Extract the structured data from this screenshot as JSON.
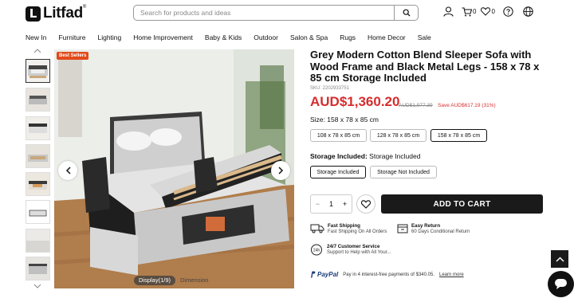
{
  "header": {
    "logo_text": "Litfad",
    "logo_mark": "L",
    "logo_reg": "®",
    "search_placeholder": "Search for products and ideas",
    "cart_count": "0",
    "wishlist_count": "0"
  },
  "nav": [
    "New In",
    "Furniture",
    "Lighting",
    "Home Improvement",
    "Baby & Kids",
    "Outdoor",
    "Salon & Spa",
    "Rugs",
    "Home Decor",
    "Sale"
  ],
  "gallery": {
    "badge": "Best Sellers",
    "tab_display": "Display(1/9)",
    "tab_dimension": "Dimension",
    "thumb_count": 8
  },
  "product": {
    "title": "Grey Modern Cotton Blend Sleeper Sofa with Wood Frame and Black Metal Legs - 158 x 78 x 85 cm Storage Included",
    "sku": "SKU: 2202933751",
    "price": "AUD$1,360.20",
    "old_price": "AUD$1,977.39",
    "save": "Save AUD$617.19 (31%)",
    "size_label": "Size:",
    "size_value": "158 x 78 x 85 cm",
    "sizes": [
      "108 x 78 x 85 cm",
      "128 x 78 x 85 cm",
      "158 x 78 x 85 cm"
    ],
    "storage_label": "Storage Included:",
    "storage_value": "Storage Included",
    "storage_options": [
      "Storage Included",
      "Storage Not Included"
    ],
    "qty": "1",
    "qty_minus": "−",
    "qty_plus": "+",
    "add_to_cart": "ADD TO CART"
  },
  "features": {
    "shipping_title": "Fast Shipping",
    "shipping_sub": "Fast Shipping On All Orders",
    "return_title": "Easy Return",
    "return_sub": "60 Days Conditional Return",
    "service_title": "24/7 Customer Service",
    "service_sub": "Support to Help with All Your...",
    "service_icon_text": "24h"
  },
  "paypal": {
    "logo": "PayPal",
    "text": "Pay in 4 interest-free payments of $340.05.",
    "link": "Learn more"
  },
  "colors": {
    "price_red": "#d62d2d",
    "badge_orange": "#e24a1b",
    "dark": "#1a1a1a"
  }
}
